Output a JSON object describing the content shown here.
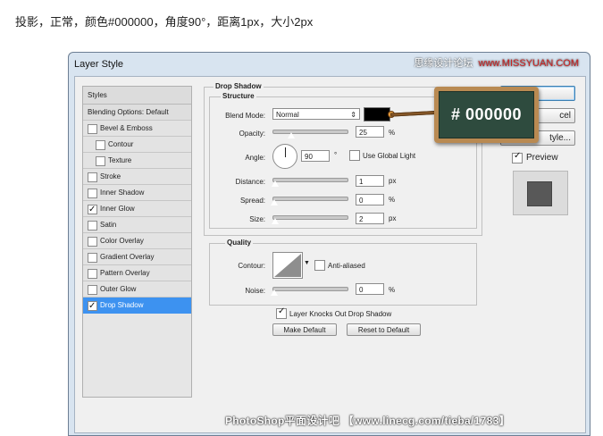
{
  "caption": "投影，正常，颜色#000000，角度90°，距离1px，大小2px",
  "window": {
    "title": "Layer Style"
  },
  "watermark_top": {
    "text": "思缘设计论坛",
    "site": "www.MISSYUAN.COM"
  },
  "watermark_bottom": "PhotoShop平面设计吧  【www.linecg.com/tieba/1783】",
  "styles_panel": {
    "header": "Styles",
    "blending": "Blending Options: Default",
    "items": [
      {
        "label": "Bevel & Emboss",
        "checked": false
      },
      {
        "label": "Contour",
        "checked": false,
        "sub": true
      },
      {
        "label": "Texture",
        "checked": false,
        "sub": true
      },
      {
        "label": "Stroke",
        "checked": false
      },
      {
        "label": "Inner Shadow",
        "checked": false
      },
      {
        "label": "Inner Glow",
        "checked": true
      },
      {
        "label": "Satin",
        "checked": false
      },
      {
        "label": "Color Overlay",
        "checked": false
      },
      {
        "label": "Gradient Overlay",
        "checked": false
      },
      {
        "label": "Pattern Overlay",
        "checked": false
      },
      {
        "label": "Outer Glow",
        "checked": false
      },
      {
        "label": "Drop Shadow",
        "checked": true,
        "selected": true
      }
    ]
  },
  "drop_shadow": {
    "group_title": "Drop Shadow",
    "structure_title": "Structure",
    "blend_mode_label": "Blend Mode:",
    "blend_mode_value": "Normal",
    "color": "#000000",
    "opacity_label": "Opacity:",
    "opacity_value": "25",
    "opacity_unit": "%",
    "angle_label": "Angle:",
    "angle_value": "90",
    "angle_unit": "°",
    "use_global_light_label": "Use Global Light",
    "use_global_light": false,
    "distance_label": "Distance:",
    "distance_value": "1",
    "distance_unit": "px",
    "spread_label": "Spread:",
    "spread_value": "0",
    "spread_unit": "%",
    "size_label": "Size:",
    "size_value": "2",
    "size_unit": "px",
    "quality_title": "Quality",
    "contour_label": "Contour:",
    "anti_aliased_label": "Anti-aliased",
    "anti_aliased": false,
    "noise_label": "Noise:",
    "noise_value": "0",
    "noise_unit": "%",
    "knocks_out_label": "Layer Knocks Out Drop Shadow",
    "knocks_out": true,
    "make_default_label": "Make Default",
    "reset_default_label": "Reset to Default"
  },
  "right_buttons": {
    "ok_label": "",
    "cancel_label": "cel",
    "new_style_label": "tyle...",
    "preview_label": "Preview",
    "preview_checked": true
  },
  "callout": {
    "text": "# 000000"
  }
}
